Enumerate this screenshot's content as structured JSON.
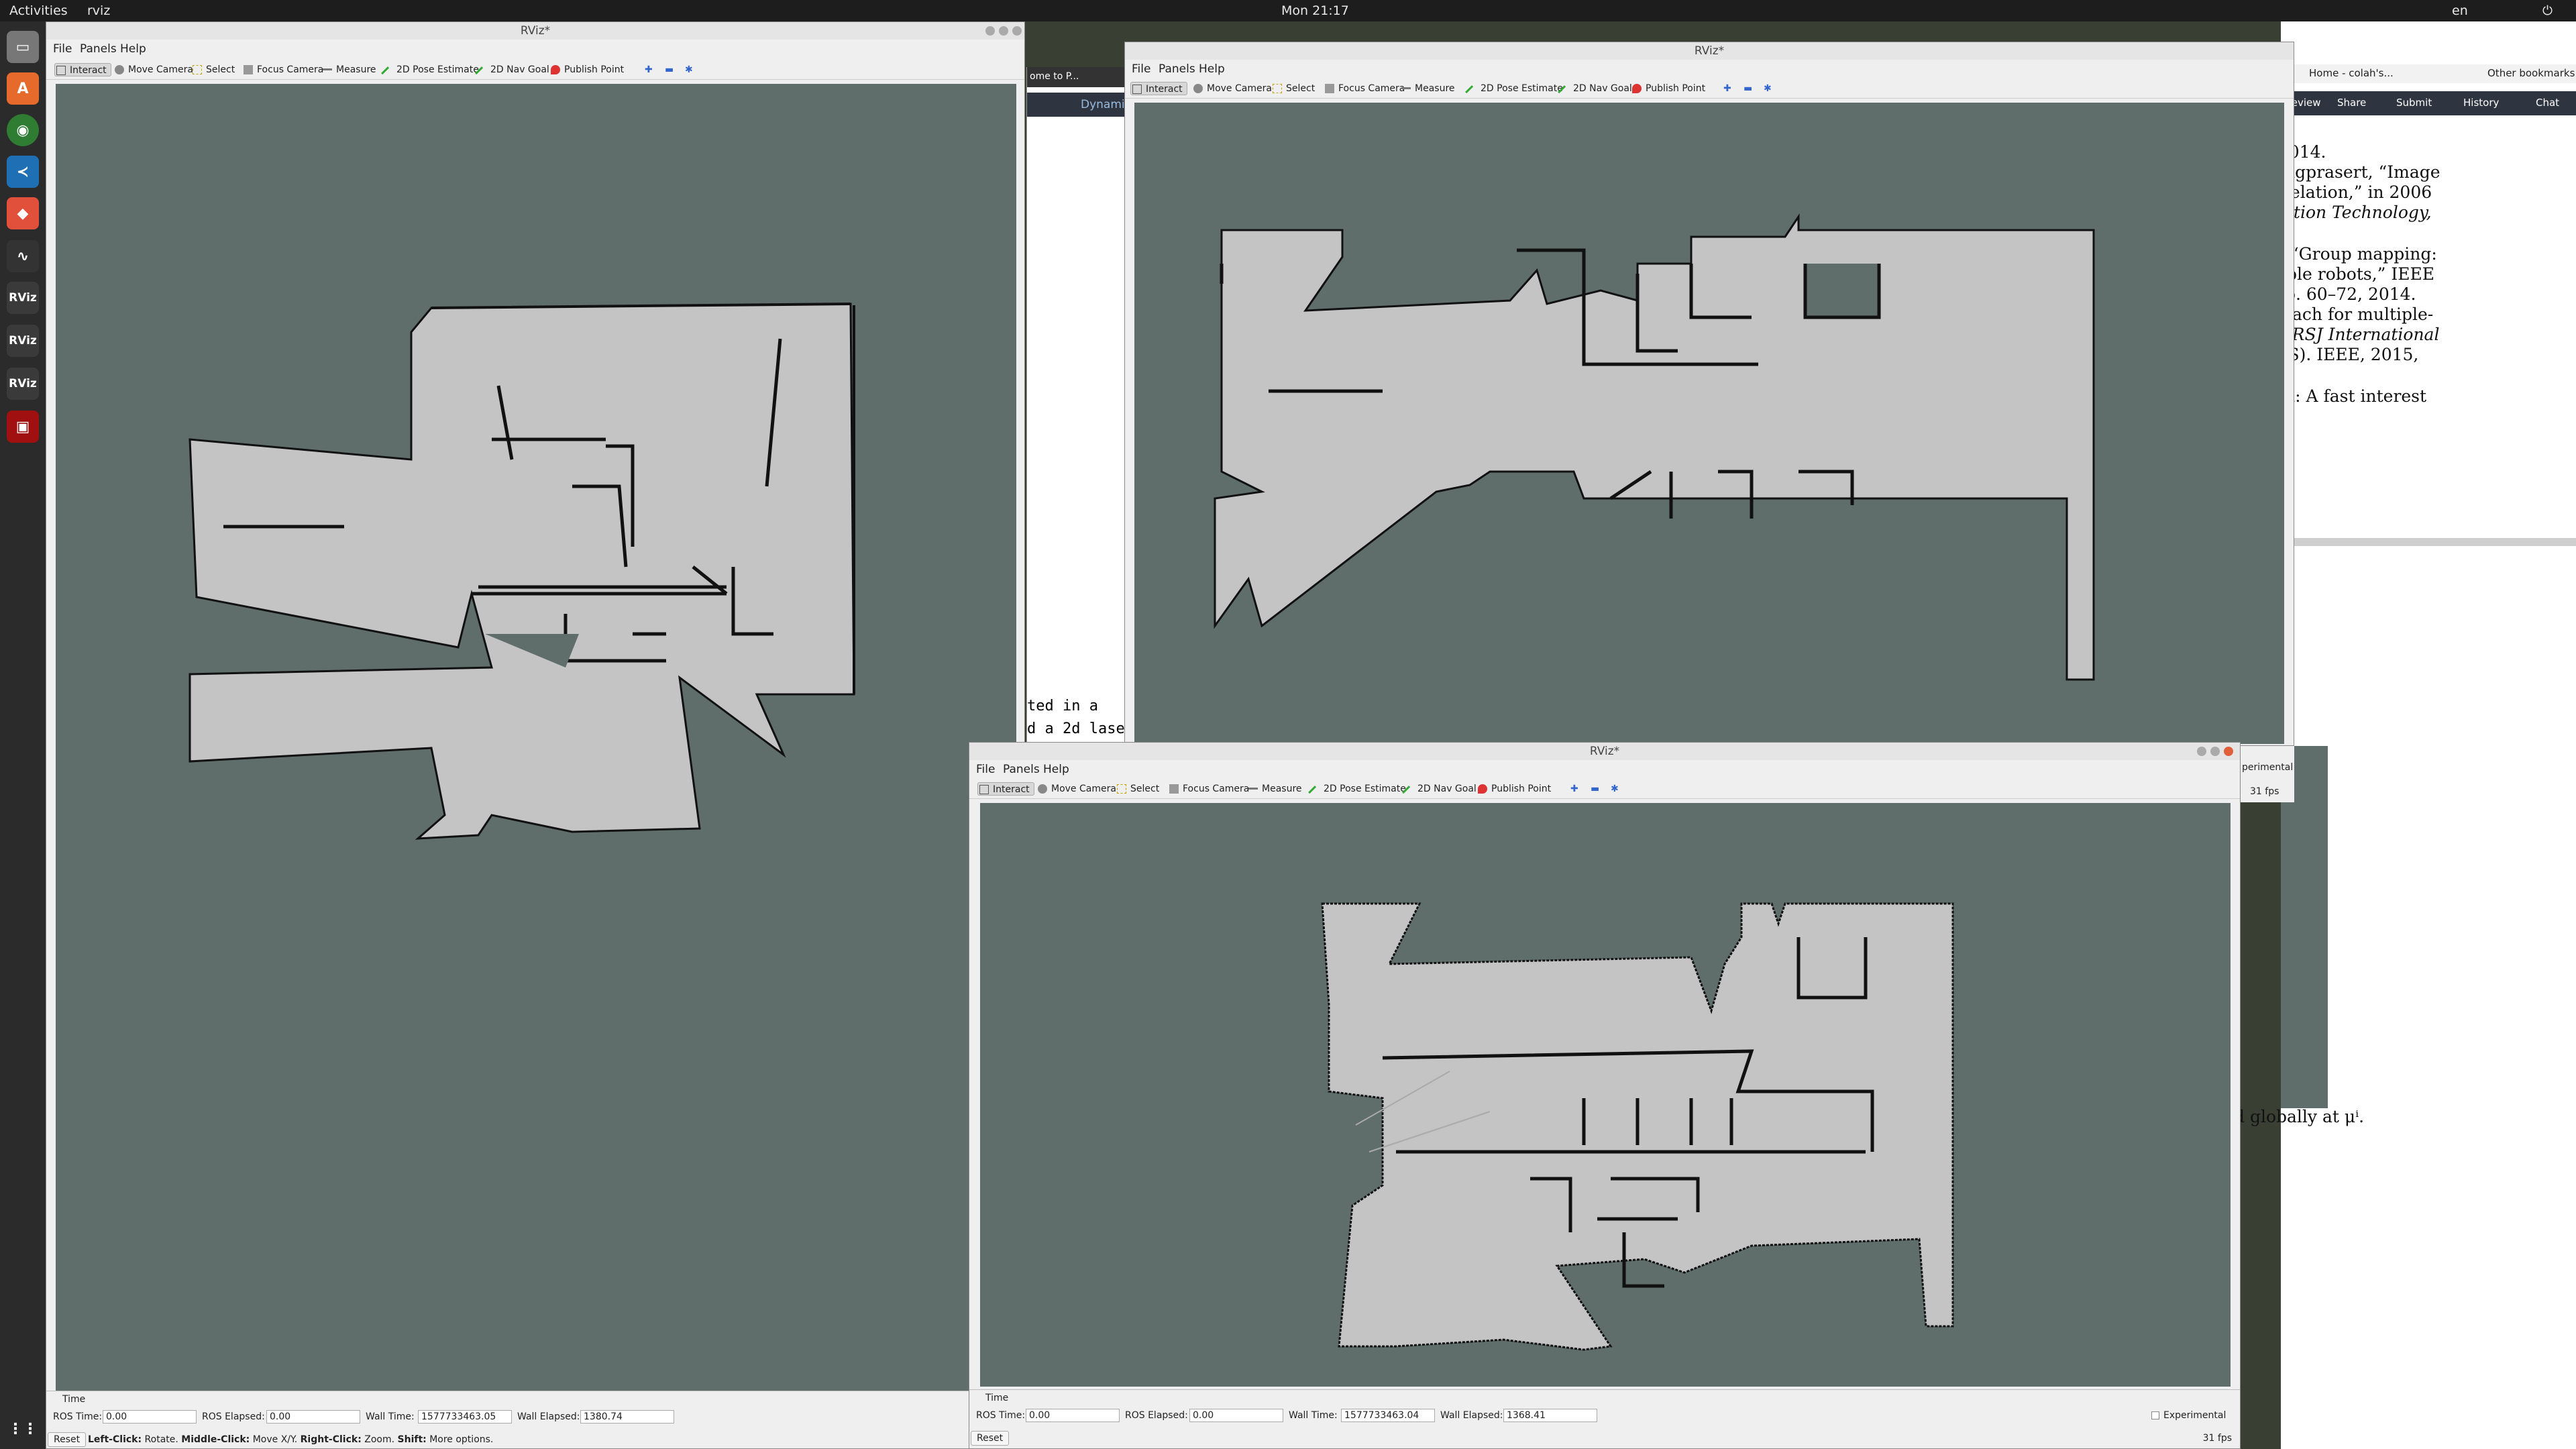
{
  "topbar": {
    "activities": "Activities",
    "app": "rviz",
    "clock": "Mon 21:17",
    "lang": "en"
  },
  "dock": {
    "items": [
      "files-icon",
      "software-icon",
      "chrome-icon",
      "vscode-icon",
      "git-icon",
      "monitor-icon",
      "rviz-icon",
      "rviz-icon",
      "rviz-icon",
      "terminal-icon",
      "apps-grid-icon"
    ],
    "rviz_label": "RViz"
  },
  "browser": {
    "bookmarks": [
      "Home - colah's...",
      "Other bookmarks"
    ],
    "actions": [
      "Review",
      "Share",
      "Submit",
      "History",
      "Chat"
    ],
    "tab_fragment": "ome to P...",
    "dynamic_label": "Dynamic",
    "paper_lines": [
      ", 2014.",
      "ongprasert, “Image",
      "rrelation,” in 2006",
      "cation Technology,",
      "i, “Group mapping:",
      "tiple robots,” IEEE",
      "pp. 60–72, 2014.",
      "roach for multiple-",
      "E/RSJ International",
      "OS).   IEEE, 2015,",
      "on: A fast interest",
      "d globally at μⁱ."
    ],
    "code_lines": [
      "ted in a",
      "d a 2d lase"
    ]
  },
  "rviz": {
    "title": "RViz*",
    "menu": [
      "File",
      "Panels",
      "Help"
    ],
    "tools": [
      "Interact",
      "Move Camera",
      "Select",
      "Focus Camera",
      "Measure",
      "2D Pose Estimate",
      "2D Nav Goal",
      "Publish Point"
    ],
    "time_panel": "Time",
    "labels": {
      "ros_time": "ROS Time:",
      "ros_elapsed": "ROS Elapsed:",
      "wall_time": "Wall Time:",
      "wall_elapsed": "Wall Elapsed:",
      "experimental": "Experimental",
      "reset": "Reset"
    },
    "win1": {
      "ros_time": "0.00",
      "ros_elapsed": "0.00",
      "wall_time": "1577733463.05",
      "wall_elapsed": "1380.74",
      "hint_left": "Left-Click:",
      "hint_rotate": "Rotate.",
      "hint_middle": "Middle-Click:",
      "hint_move": "Move X/Y.",
      "hint_right": "Right-Click:",
      "hint_zoom": "Zoom.",
      "hint_shift": "Shift:",
      "hint_more": "More options."
    },
    "win3": {
      "ros_time": "0.00",
      "ros_elapsed": "0.00",
      "wall_time": "1577733463.04",
      "wall_elapsed": "1368.41",
      "fps": "31 fps"
    },
    "win2": {
      "fps": "31 fps",
      "experimental_fragment": "perimental"
    }
  },
  "colors": {
    "map_bg": "#5f6e6b",
    "free": "#c4c4c4",
    "wall": "#111111"
  }
}
